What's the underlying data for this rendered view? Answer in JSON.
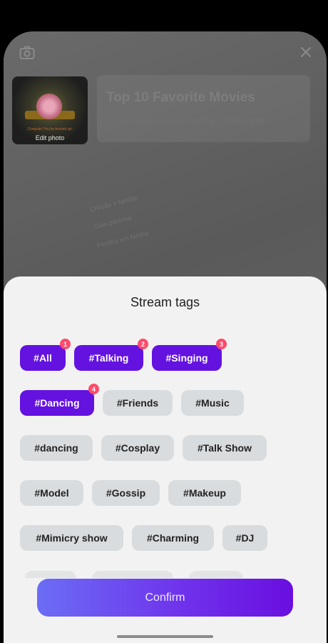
{
  "background": {
    "thumbnail_caption": "Edit photo",
    "thumbnail_tiny_text": "Congrats! You've leveled up!",
    "title": "Top 10 Favorite Movies",
    "tags_line": "#All  #Talking  #Singing  #Dancing",
    "faint_text": [
      "Criação e família",
      "Guia parental",
      "Partilha em família"
    ]
  },
  "sheet": {
    "title": "Stream tags",
    "tags": [
      {
        "label": "#All",
        "selected": true,
        "order": "1"
      },
      {
        "label": "#Talking",
        "selected": true,
        "order": "2"
      },
      {
        "label": "#Singing",
        "selected": true,
        "order": "3"
      },
      {
        "label": "#Dancing",
        "selected": true,
        "order": "4"
      },
      {
        "label": "#Friends",
        "selected": false
      },
      {
        "label": "#Music",
        "selected": false
      },
      {
        "label": "#dancing",
        "selected": false
      },
      {
        "label": "#Cosplay",
        "selected": false
      },
      {
        "label": "#Talk Show",
        "selected": false
      },
      {
        "label": "#Model",
        "selected": false
      },
      {
        "label": "#Gossip",
        "selected": false
      },
      {
        "label": "#Makeup",
        "selected": false
      },
      {
        "label": "#Mimicry show",
        "selected": false
      },
      {
        "label": "#Charming",
        "selected": false
      },
      {
        "label": "#DJ",
        "selected": false
      }
    ],
    "confirm_label": "Confirm"
  },
  "colors": {
    "selected_tag": "#6312e0",
    "badge": "#ff4a6a",
    "confirm_gradient_start": "#6b6df5",
    "confirm_gradient_end": "#6a0ee0"
  }
}
